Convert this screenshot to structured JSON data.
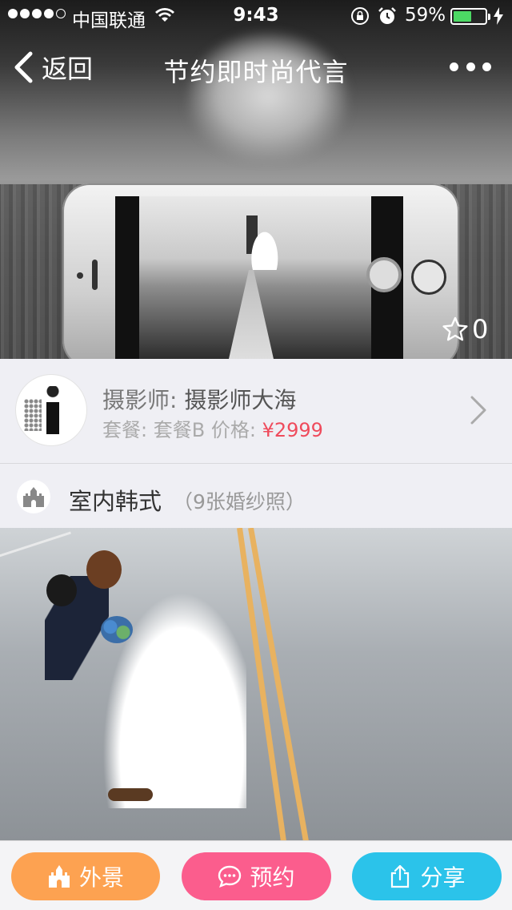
{
  "status_bar": {
    "carrier": "中国联通",
    "time": "9:43",
    "battery_percent": "59%",
    "battery_level": 0.59,
    "signal_bars": 4
  },
  "nav": {
    "back_label": "返回",
    "title": "节约即时尚代言"
  },
  "favorite_count": "0",
  "photographer": {
    "label": "摄影师:",
    "name": "摄影师大海",
    "package_label": "套餐:",
    "package": "套餐B",
    "price_label": "价格:",
    "price": "¥2999"
  },
  "section": {
    "title": "室内韩式",
    "count": "（9张婚纱照）"
  },
  "actions": {
    "outdoor_label": "外景",
    "book_label": "预约",
    "share_label": "分享"
  },
  "colors": {
    "outdoor": "#fda251",
    "book": "#fb5d8d",
    "share": "#2bc3ea",
    "price": "#ef4b5c",
    "battery": "#4cd964"
  }
}
